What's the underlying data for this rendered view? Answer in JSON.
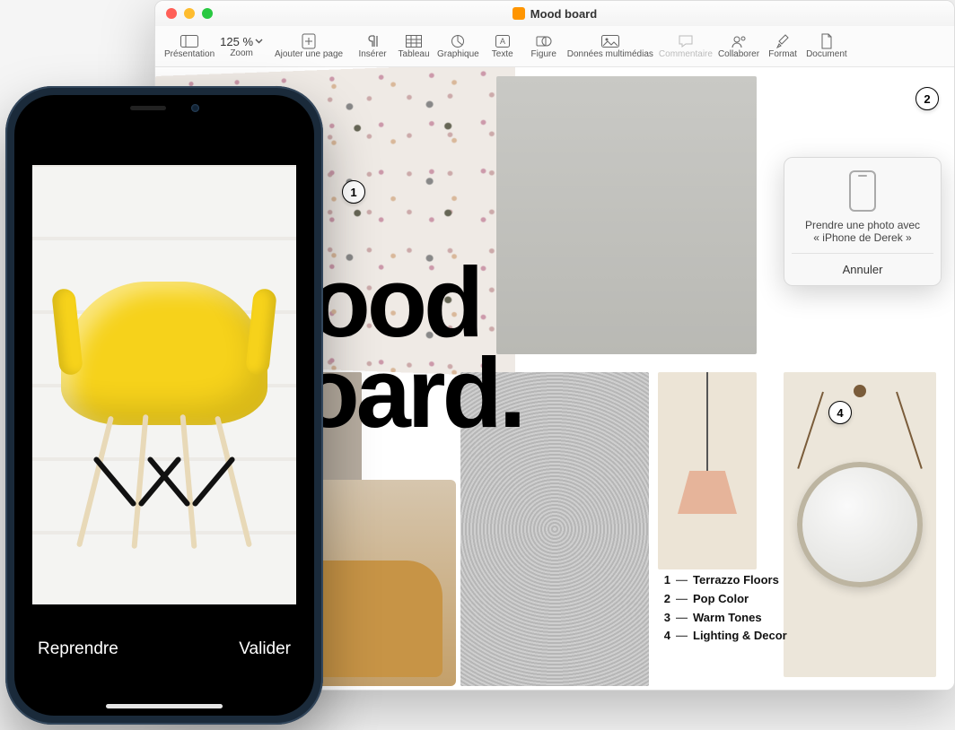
{
  "window": {
    "title": "Mood board"
  },
  "toolbar": {
    "presentation": "Présentation",
    "zoom_label": "Zoom",
    "zoom_value": "125 %",
    "add_page": "Ajouter une page",
    "insert": "Insérer",
    "table": "Tableau",
    "chart": "Graphique",
    "text": "Texte",
    "shape": "Figure",
    "media": "Données multimédias",
    "comment": "Commentaire",
    "collaborate": "Collaborer",
    "format": "Format",
    "document": "Document"
  },
  "document": {
    "headline_l1": "Mood",
    "headline_l2": "Board."
  },
  "legend": {
    "items": [
      {
        "num": "1",
        "label": "Terrazzo Floors"
      },
      {
        "num": "2",
        "label": "Pop Color"
      },
      {
        "num": "3",
        "label": "Warm Tones"
      },
      {
        "num": "4",
        "label": "Lighting & Decor"
      }
    ]
  },
  "callouts": {
    "c1": "1",
    "c2": "2",
    "c4": "4"
  },
  "popover": {
    "line1": "Prendre une photo avec",
    "line2": "« iPhone de Derek »",
    "cancel": "Annuler"
  },
  "iphone": {
    "retake": "Reprendre",
    "use": "Valider"
  }
}
